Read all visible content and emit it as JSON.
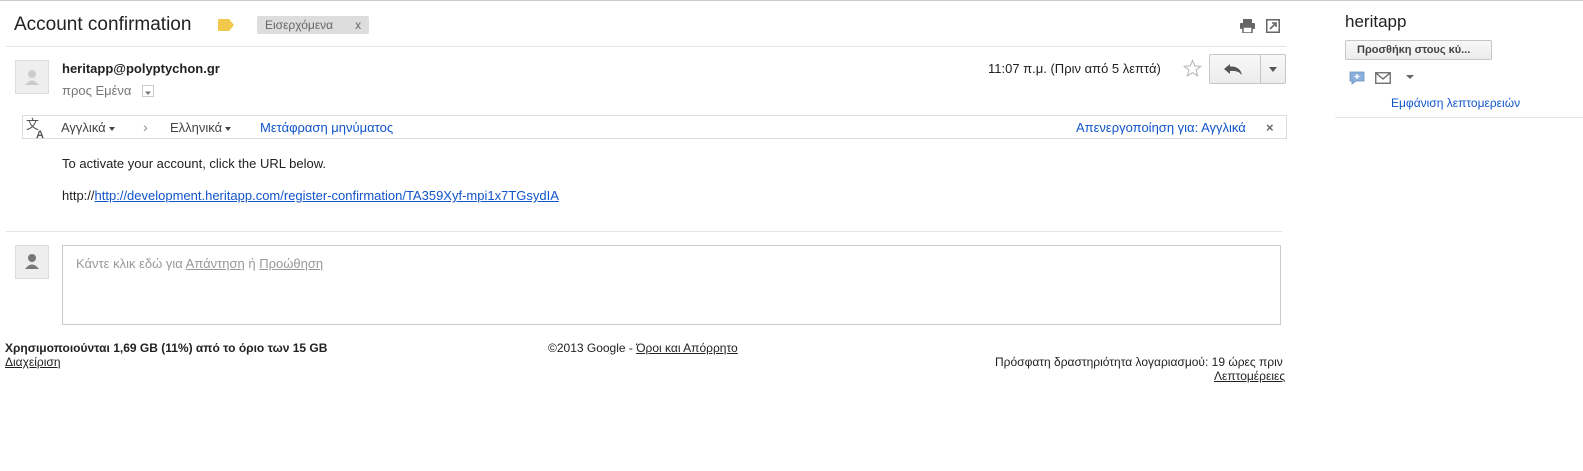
{
  "message": {
    "subject": "Account confirmation",
    "label": "Εισερχόμενα",
    "label_remove": "x",
    "sender_email": "heritapp@polyptychon.gr",
    "to_line": "προς Εμένα",
    "timestamp": "11:07 π.μ. (Πριν από 5 λεπτά)",
    "body_line1": "To activate your account, click the URL below.",
    "body_prefix": "http://",
    "body_link": "http://development.heritapp.com/register-confirmation/TA359Xyf-mpi1x7TGsydIA"
  },
  "translate": {
    "from_lang": "Αγγλικά",
    "arrow": "›",
    "to_lang": "Ελληνικά",
    "translate_link": "Μετάφραση μηνύματος",
    "disable_link": "Απενεργοποίηση για: Αγγλικά",
    "close": "×"
  },
  "reply": {
    "prompt_before": "Κάντε κλικ εδώ για ",
    "reply_label": "Απάντηση",
    "or": " ή ",
    "forward_label": "Προώθηση"
  },
  "footer": {
    "storage": "Χρησιμοποιούνται 1,69 GB (11%) από το όριο των 15 GB",
    "manage": "Διαχείριση",
    "copyright": "©2013 Google - ",
    "terms": "Όροι και Απόρρητο",
    "activity": "Πρόσφατη δραστηριότητα λογαριασμού: 19 ώρες πριν",
    "details": "Λεπτομέρειες"
  },
  "sidebar": {
    "contact_name": "heritapp",
    "add_circles": "Προσθήκη στους κύ...",
    "show_details": "Εμφάνιση λεπτομερειών"
  },
  "icons": {
    "label_tag": "label-tag-icon",
    "print": "print-icon",
    "new_window": "new-window-icon",
    "star": "star-icon",
    "reply": "reply-arrow-icon",
    "more": "chevron-down-icon",
    "translate": "translate-icon",
    "chat": "chat-icon",
    "mail": "mail-icon",
    "avatar": "person-avatar-icon"
  },
  "colors": {
    "link": "#1155cc",
    "label_tag": "#f2c94c",
    "label_bg": "#dddddd"
  }
}
